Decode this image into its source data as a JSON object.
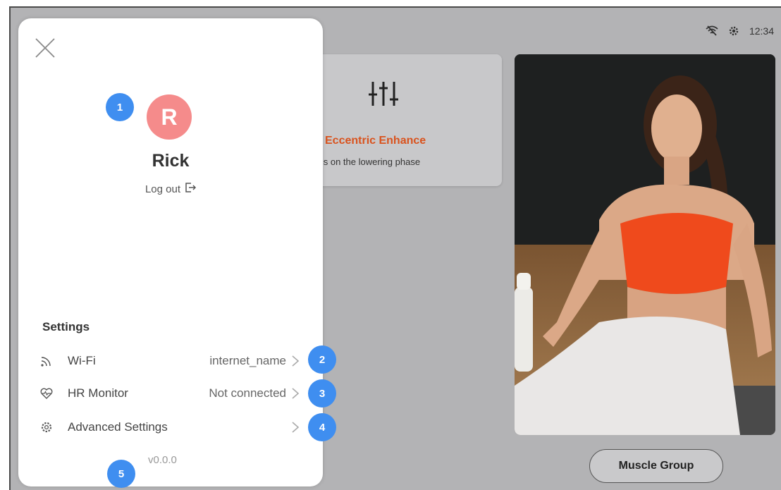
{
  "status_bar": {
    "time": "12:34",
    "wifi_icon": "wifi-off-icon",
    "settings_icon": "gear-icon"
  },
  "mode_card": {
    "icon": "sliders-icon",
    "title": "Eccentric Enhance",
    "subtitle": "cus on the lowering phase"
  },
  "photo": {
    "subject": "woman in orange sports bra"
  },
  "muscle_group_button": "Muscle Group",
  "panel": {
    "close_icon": "close-icon",
    "avatar_initial": "R",
    "user_name": "Rick",
    "logout_label": "Log out",
    "settings_title": "Settings",
    "settings_items": [
      {
        "label": "Wi-Fi",
        "value": "internet_name",
        "icon": "wifi-icon"
      },
      {
        "label": "HR Monitor",
        "value": "Not connected",
        "icon": "heart-rate-icon"
      },
      {
        "label": "Advanced Settings",
        "value": "",
        "icon": "gear-icon"
      }
    ],
    "version": "v0.0.0"
  },
  "badges": [
    "1",
    "2",
    "3",
    "4",
    "5"
  ],
  "colors": {
    "accent_orange": "#d9531e",
    "avatar_bg": "#f58b8b",
    "badge_blue": "#3f8ef0",
    "backdrop": "#b3b3b5"
  }
}
